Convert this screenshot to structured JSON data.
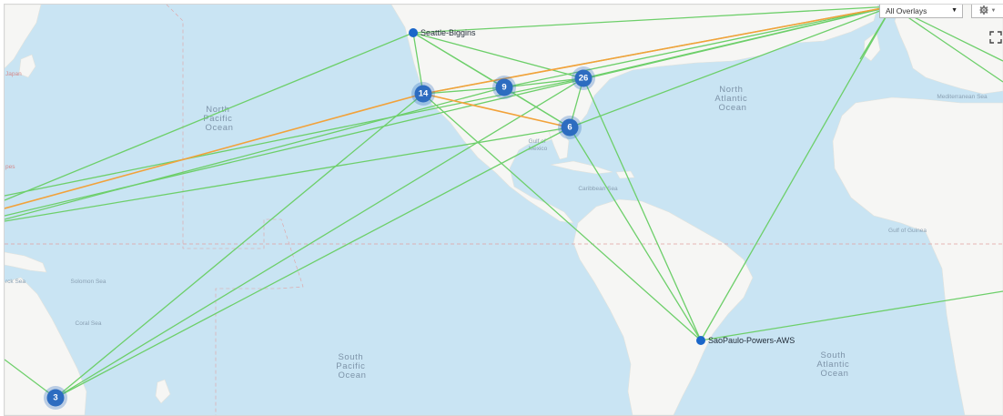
{
  "toolbar": {
    "overlay_select_value": "All Overlays",
    "overlay_select_caret": "▼",
    "settings_icon": "gear-icon",
    "settings_caret": "▼",
    "fullscreen_icon": "fullscreen-icon"
  },
  "colors": {
    "water": "#c9e4f3",
    "land": "#f6f6f4",
    "link_normal": "#6dcf6a",
    "link_degraded": "#f2a23a",
    "node": "#1a66c9",
    "cluster": "#2d6cc0"
  },
  "nodes": [
    {
      "id": "seattle",
      "label": "Seattle-Biggins"
    },
    {
      "id": "saopaulo",
      "label": "SaoPaulo-Powers-AWS"
    }
  ],
  "clusters": [
    {
      "id": "c14",
      "count": "14"
    },
    {
      "id": "c9",
      "count": "9"
    },
    {
      "id": "c26",
      "count": "26"
    },
    {
      "id": "c6",
      "count": "6"
    },
    {
      "id": "c3",
      "count": "3"
    }
  ],
  "ocean_labels": {
    "north_pacific": [
      "North",
      "Pacific",
      "Ocean"
    ],
    "south_pacific": [
      "South",
      "Pacific",
      "Ocean"
    ],
    "north_atlantic": [
      "North",
      "Atlantic",
      "Ocean"
    ],
    "south_atlantic": [
      "South",
      "Atlantic",
      "Ocean"
    ]
  },
  "sea_labels": {
    "gulf_of_mexico": [
      "Gulf of",
      "Mexico"
    ],
    "caribbean": "Caribbean Sea",
    "gulf_of_guinea": "Gulf of Guinea",
    "mediterranean": "Mediterranean Sea",
    "solomon": "Solomon Sea",
    "coral": "Coral Sea",
    "bismarck": "rck Sea"
  },
  "land_labels": {
    "japan": "Japan",
    "pes": "pes"
  }
}
